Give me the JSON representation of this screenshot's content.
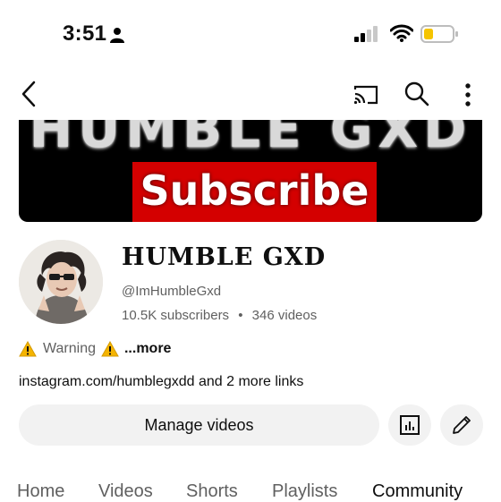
{
  "status_bar": {
    "time": "3:51",
    "icons": [
      "person-icon",
      "signal-icon",
      "wifi-icon",
      "battery-icon"
    ],
    "battery_color": "#f5c400"
  },
  "nav": {
    "icons": [
      "back-icon",
      "cast-icon",
      "search-icon",
      "more-icon"
    ]
  },
  "banner": {
    "title": "HUMBLE GXD",
    "subscribe_label": "Subscribe",
    "colors": {
      "background": "#000000",
      "subscribe_box": "#d40000"
    }
  },
  "channel": {
    "name": "HUMBLE GXD",
    "handle": "@ImHumbleGxd",
    "subscribers": "10.5K subscribers",
    "separator": "•",
    "videos": "346 videos",
    "description": {
      "prefix_icon": "warning-icon",
      "text": "Warning",
      "suffix_icon": "warning-icon",
      "more_label": "...more"
    },
    "links": {
      "primary": "instagram.com/humblegxdd",
      "more": " and 2 more links"
    }
  },
  "actions": {
    "manage_label": "Manage videos",
    "analytics_icon": "analytics-icon",
    "edit_icon": "pencil-icon"
  },
  "tabs": [
    {
      "label": "Home",
      "active": false
    },
    {
      "label": "Videos",
      "active": false
    },
    {
      "label": "Shorts",
      "active": false
    },
    {
      "label": "Playlists",
      "active": false
    },
    {
      "label": "Community",
      "active": true
    }
  ]
}
